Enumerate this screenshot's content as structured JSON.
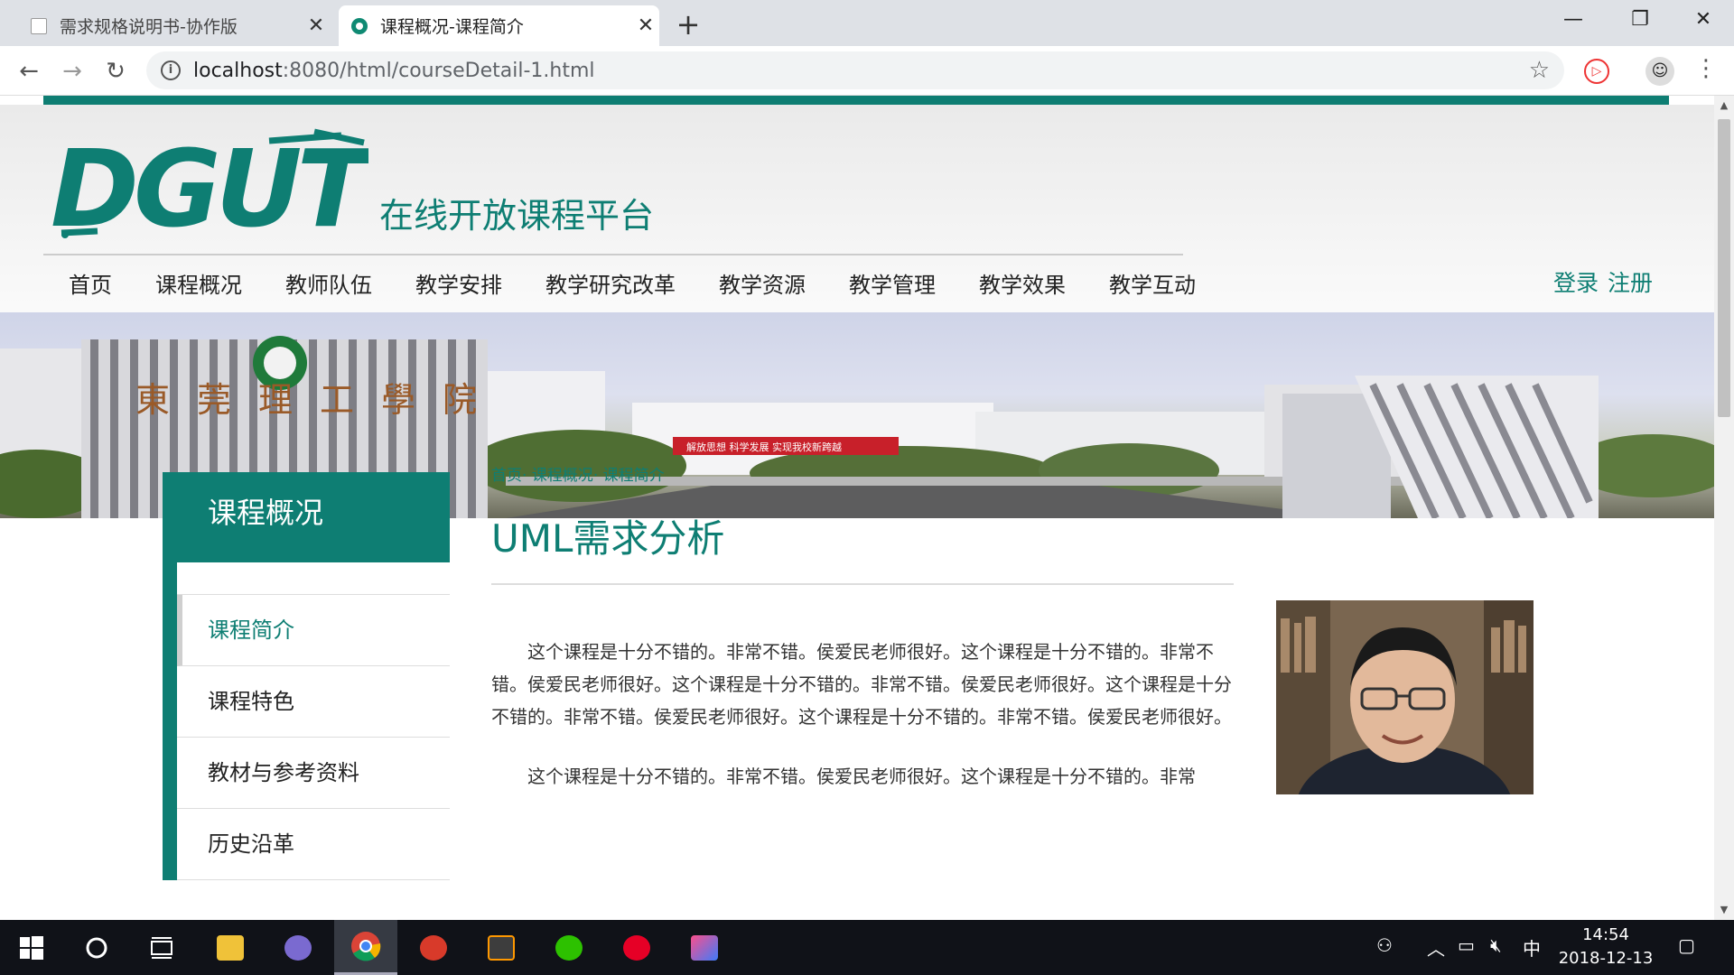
{
  "browser": {
    "tabs": [
      {
        "title": "需求规格说明书-协作版",
        "active": false
      },
      {
        "title": "课程概况-课程简介",
        "active": true
      }
    ],
    "new_tab": "+",
    "window_controls": {
      "minimize": "—",
      "restore": "❐",
      "close": "✕"
    },
    "url_host": "localhost",
    "url_path": ":8080/html/courseDetail-1.html",
    "nav": {
      "back": "←",
      "forward": "→",
      "reload": "↻"
    }
  },
  "site": {
    "logo_text": "DGUT",
    "name": "在线开放课程平台",
    "nav_items": [
      "首页",
      "课程概况",
      "教师队伍",
      "教学安排",
      "教学研究改革",
      "教学资源",
      "教学管理",
      "教学效果",
      "教学互动"
    ],
    "login": "登录",
    "register": "注册",
    "accent_color": "#0e7e73"
  },
  "banner": {
    "school_name": "東莞理工學院",
    "slogan": "解放思想 科学发展 实现我校新跨越"
  },
  "sidebar": {
    "heading": "课程概况",
    "items": [
      "课程简介",
      "课程特色",
      "教材与参考资料",
      "历史沿革"
    ],
    "active_index": 0
  },
  "content": {
    "breadcrumb": [
      "首页",
      "课程概况",
      "课程简介"
    ],
    "breadcrumb_sep": "·",
    "title": "UML需求分析",
    "paragraphs": [
      "这个课程是十分不错的。非常不错。侯爱民老师很好。这个课程是十分不错的。非常不错。侯爱民老师很好。这个课程是十分不错的。非常不错。侯爱民老师很好。这个课程是十分不错的。非常不错。侯爱民老师很好。这个课程是十分不错的。非常不错。侯爱民老师很好。",
      "这个课程是十分不错的。非常不错。侯爱民老师很好。这个课程是十分不错的。非常"
    ]
  },
  "taskbar": {
    "time": "14:54",
    "date": "2018-12-13",
    "ime": "中"
  }
}
